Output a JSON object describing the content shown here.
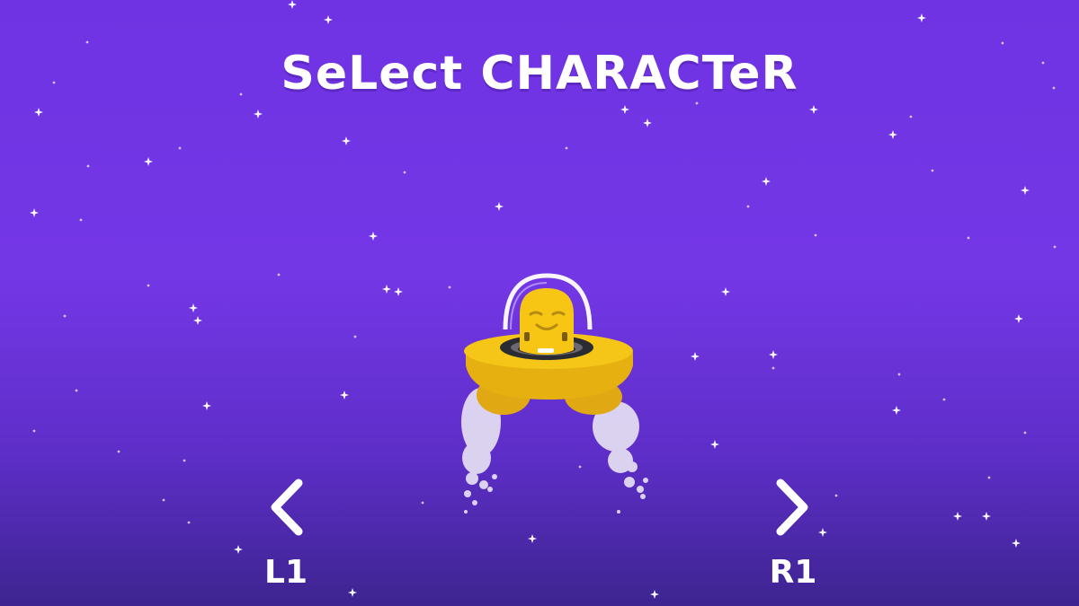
{
  "screen": {
    "title": "SeLect CHARACTeR"
  },
  "controls": {
    "prev_key": "L1",
    "next_key": "R1",
    "prev_icon": "chevron-left-icon",
    "next_icon": "chevron-right-icon"
  },
  "character": {
    "kind": "yellow alien in flying saucer"
  },
  "colors": {
    "background_top": "#6f33e3",
    "background_bottom": "#3d2490",
    "ufo_yellow": "#f5c518",
    "text": "#ffffff"
  }
}
